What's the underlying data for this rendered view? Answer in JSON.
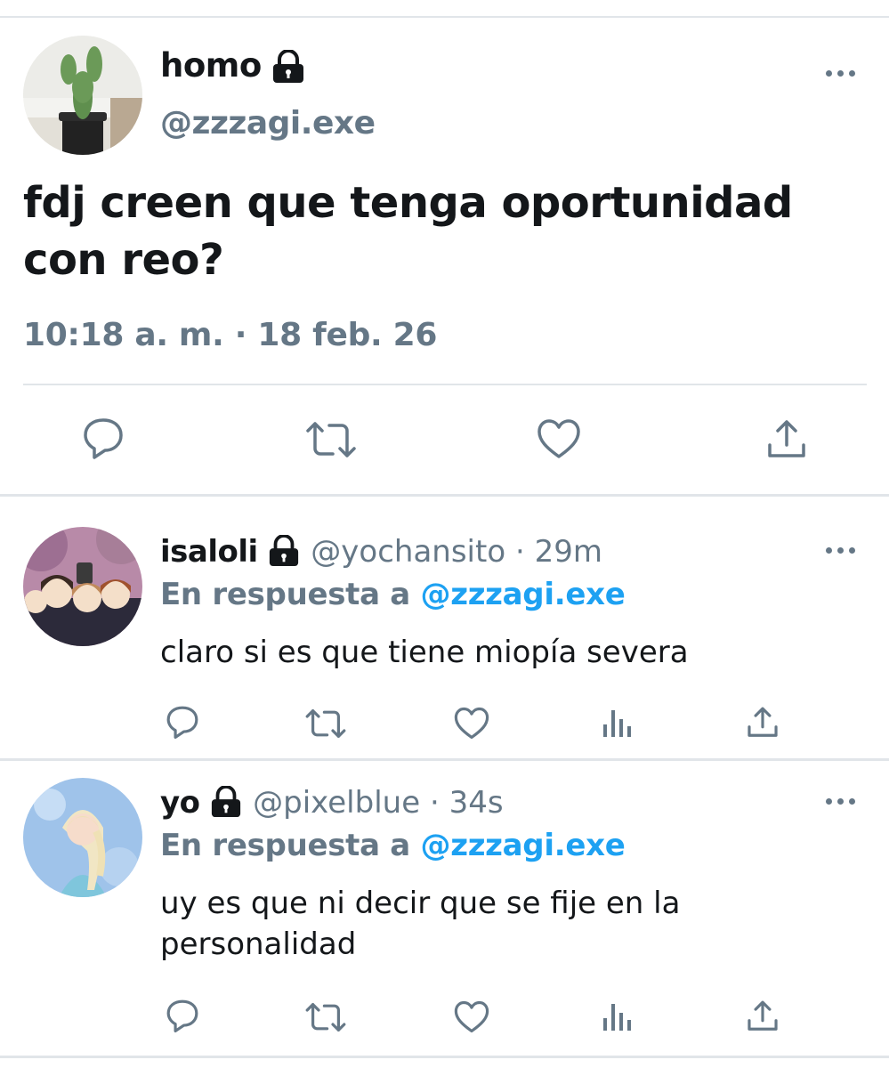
{
  "main_tweet": {
    "display_name": "homo",
    "handle": "@zzzagi.exe",
    "text": "fdj creen que tenga oportunidad con reo?",
    "timestamp": "10:18 a. m. · 18 feb. 26",
    "avatar": "cactus-avatar",
    "actions": [
      "reply-icon",
      "retweet-icon",
      "like-icon",
      "share-icon"
    ]
  },
  "replies": [
    {
      "display_name": "isaloli",
      "handle": "@yochansito",
      "dot": "·",
      "time": "29m",
      "reply_prefix": "En respuesta a",
      "reply_to": "@zzzagi.exe",
      "text": "claro si es que tiene miopía severa",
      "avatar": "anime-group-avatar"
    },
    {
      "display_name": "yo",
      "handle": "@pixelblue",
      "dot": "·",
      "time": "34s",
      "reply_prefix": "En respuesta a",
      "reply_to": "@zzzagi.exe",
      "text": "uy es que ni decir que se fije en la personalidad",
      "avatar": "elsa-avatar"
    }
  ],
  "colors": {
    "text": "#14171a",
    "secondary": "#657786",
    "accent": "#1da1f2",
    "divider": "#e1e5e9"
  }
}
